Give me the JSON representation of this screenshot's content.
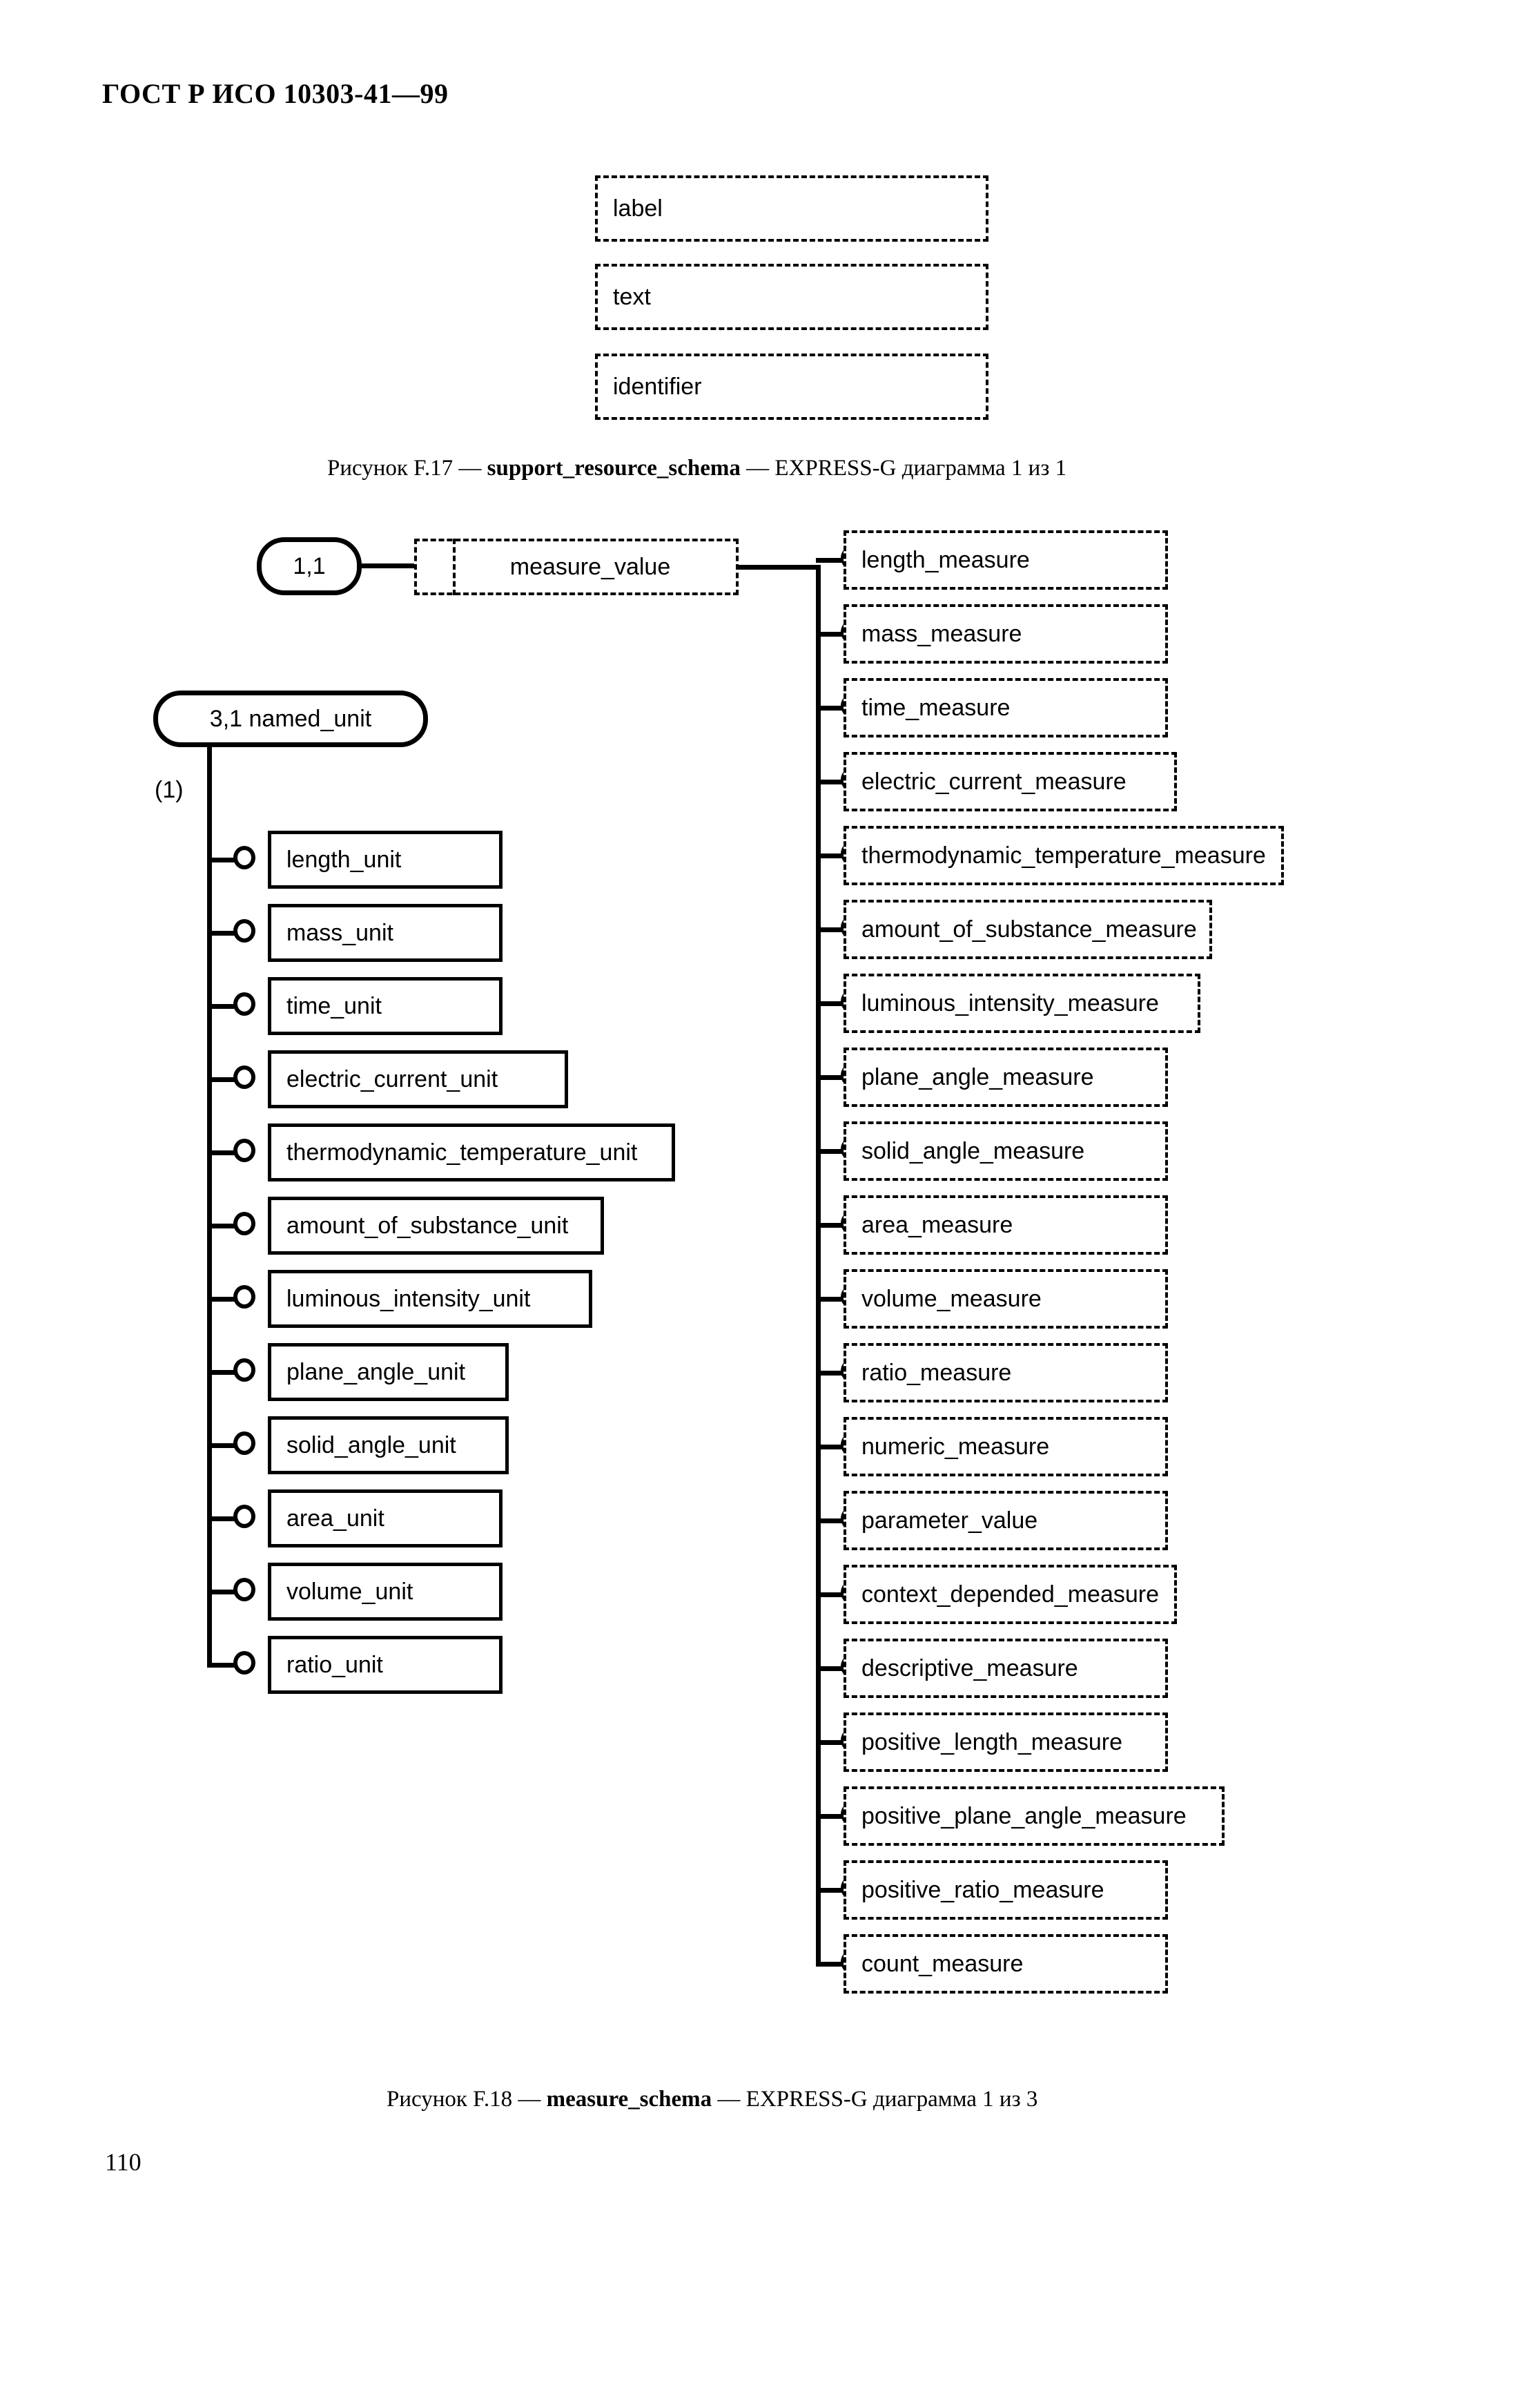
{
  "document": {
    "running_head": "ГОСТ Р ИСО 10303-41—99",
    "page_number": "110"
  },
  "figure_f17": {
    "caption_prefix": "Рисунок F.17 — ",
    "caption_schema": "support_resource_schema",
    "caption_suffix": " — EXPRESS-G диаграмма 1 из 1",
    "nodes": [
      {
        "label": "label",
        "kind": "defined"
      },
      {
        "label": "text",
        "kind": "defined"
      },
      {
        "label": "identifier",
        "kind": "defined"
      }
    ]
  },
  "figure_f18": {
    "caption_prefix": "Рисунок F.18 — ",
    "caption_schema": "measure_schema",
    "caption_suffix": " — EXPRESS-G диаграмма 1 из 3",
    "page_reference": {
      "label": "1,1",
      "kind": "page-ref"
    },
    "select_node": {
      "label": "measure_value",
      "kind": "defined-select"
    },
    "supertype_reference": {
      "label": "3,1 named_unit",
      "kind": "page-ref"
    },
    "supertype_annotation": "(1)",
    "unit_subtypes": [
      {
        "label": "length_unit",
        "kind": "entity"
      },
      {
        "label": "mass_unit",
        "kind": "entity"
      },
      {
        "label": "time_unit",
        "kind": "entity"
      },
      {
        "label": "electric_current_unit",
        "kind": "entity"
      },
      {
        "label": "thermodynamic_temperature_unit",
        "kind": "entity"
      },
      {
        "label": "amount_of_substance_unit",
        "kind": "entity"
      },
      {
        "label": "luminous_intensity_unit",
        "kind": "entity"
      },
      {
        "label": "plane_angle_unit",
        "kind": "entity"
      },
      {
        "label": "solid_angle_unit",
        "kind": "entity"
      },
      {
        "label": "area_unit",
        "kind": "entity"
      },
      {
        "label": "volume_unit",
        "kind": "entity"
      },
      {
        "label": "ratio_unit",
        "kind": "entity"
      }
    ],
    "measure_select_items": [
      {
        "label": "length_measure",
        "kind": "defined"
      },
      {
        "label": "mass_measure",
        "kind": "defined"
      },
      {
        "label": "time_measure",
        "kind": "defined"
      },
      {
        "label": "electric_current_measure",
        "kind": "defined"
      },
      {
        "label": "thermodynamic_temperature_measure",
        "kind": "defined"
      },
      {
        "label": "amount_of_substance_measure",
        "kind": "defined"
      },
      {
        "label": "luminous_intensity_measure",
        "kind": "defined"
      },
      {
        "label": "plane_angle_measure",
        "kind": "defined"
      },
      {
        "label": "solid_angle_measure",
        "kind": "defined"
      },
      {
        "label": "area_measure",
        "kind": "defined"
      },
      {
        "label": "volume_measure",
        "kind": "defined"
      },
      {
        "label": "ratio_measure",
        "kind": "defined"
      },
      {
        "label": "numeric_measure",
        "kind": "defined"
      },
      {
        "label": "parameter_value",
        "kind": "defined"
      },
      {
        "label": "context_depended_measure",
        "kind": "defined"
      },
      {
        "label": "descriptive_measure",
        "kind": "defined"
      },
      {
        "label": "positive_length_measure",
        "kind": "defined"
      },
      {
        "label": "positive_plane_angle_measure",
        "kind": "defined"
      },
      {
        "label": "positive_ratio_measure",
        "kind": "defined"
      },
      {
        "label": "count_measure",
        "kind": "defined"
      }
    ]
  },
  "colors": {
    "ink": "#000000",
    "paper": "#ffffff"
  }
}
